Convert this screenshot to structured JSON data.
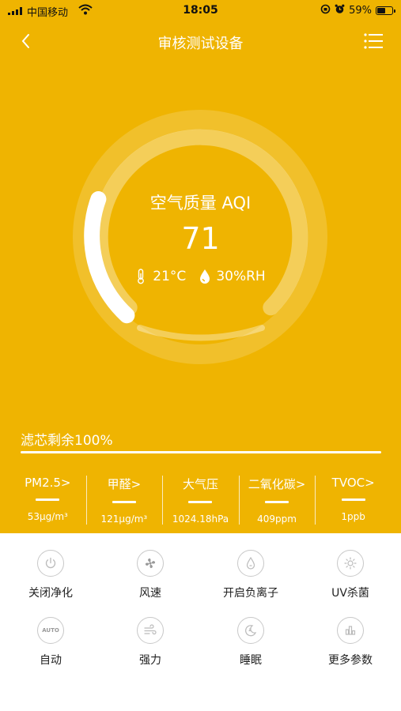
{
  "status_bar": {
    "carrier": "中国移动",
    "time": "18:05",
    "battery": "59%",
    "battery_level": 0.59
  },
  "nav": {
    "title": "审核测试设备",
    "back_icon": "chevron-left-icon",
    "menu_icon": "list-menu-icon"
  },
  "gauge": {
    "label": "空气质量 AQI",
    "value": "71",
    "temperature": "21°C",
    "humidity": "30%RH"
  },
  "filter": {
    "label": "滤芯剩余100%",
    "level": 1.0
  },
  "params": [
    {
      "name": "PM2.5>",
      "value": "53μg/m³"
    },
    {
      "name": "甲醛>",
      "value": "121μg/m³"
    },
    {
      "name": "大气压",
      "value": "1024.18hPa"
    },
    {
      "name": "二氧化碳>",
      "value": "409ppm"
    },
    {
      "name": "TVOC>",
      "value": "1ppb"
    }
  ],
  "controls": [
    {
      "label": "关闭净化",
      "icon": "power-icon"
    },
    {
      "label": "风速",
      "icon": "fan-icon"
    },
    {
      "label": "开启负离子",
      "icon": "ion-drop-icon"
    },
    {
      "label": "UV杀菌",
      "icon": "uv-sun-icon"
    },
    {
      "label": "自动",
      "icon": "auto-icon",
      "badge": "AUTO"
    },
    {
      "label": "强力",
      "icon": "wind-icon"
    },
    {
      "label": "睡眠",
      "icon": "moon-icon"
    },
    {
      "label": "更多参数",
      "icon": "bar-chart-icon"
    }
  ],
  "colors": {
    "accent": "#EFB401",
    "white": "#FFFFFF",
    "icon_gray": "#C8C8C8"
  }
}
